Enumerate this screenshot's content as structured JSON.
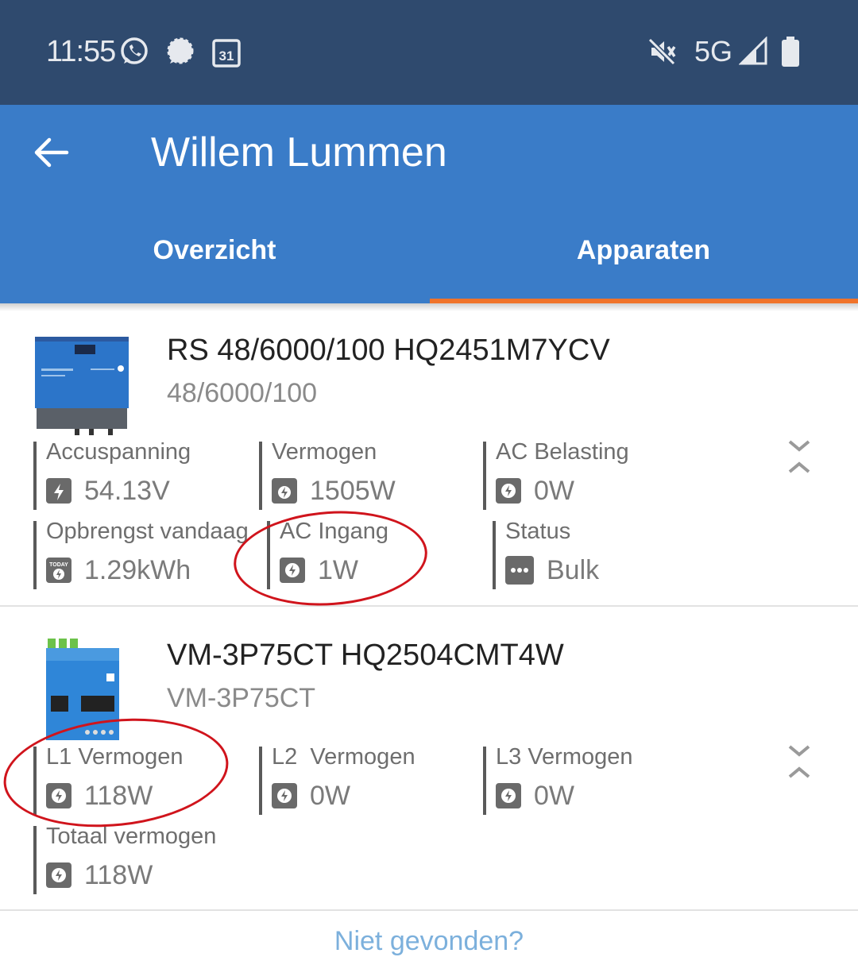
{
  "status_bar": {
    "time": "11:55",
    "network": "5G",
    "icons": [
      "whatsapp-icon",
      "signal-chat-icon",
      "calendar-icon",
      "mute-icon",
      "signal-strength-icon",
      "battery-icon"
    ],
    "calendar_day": "31"
  },
  "app_bar": {
    "title": "Willem Lummen",
    "back_icon": "arrow-left-icon"
  },
  "tabs": [
    {
      "label": "Overzicht",
      "selected": false
    },
    {
      "label": "Apparaten",
      "selected": true
    }
  ],
  "colors": {
    "accent": "#f0732a",
    "appbar": "#3a7cc8",
    "statusbar": "#2f4a6e",
    "annotation": "#d0141c",
    "link": "#7cb0dc"
  },
  "devices": [
    {
      "title": "RS 48/6000/100 HQ2451M7YCV",
      "subtitle": "48/6000/100",
      "items": [
        {
          "label": "Accuspanning",
          "value": "54.13V",
          "icon": "battery-bolt-icon"
        },
        {
          "label": "Vermogen",
          "value": "1505W",
          "icon": "solar-bolt-icon"
        },
        {
          "label": "AC Belasting",
          "value": "0W",
          "icon": "ac-bolt-icon"
        },
        {
          "label": "Opbrengst vandaag",
          "value": "1.29kWh",
          "icon": "today-solar-icon",
          "icon_text": "TODAY"
        },
        {
          "label": "AC Ingang",
          "value": "1W",
          "icon": "ac-bolt-icon"
        },
        {
          "label": "Status",
          "value": "Bulk",
          "icon": "more-dots-icon"
        }
      ]
    },
    {
      "title": "VM-3P75CT HQ2504CMT4W",
      "subtitle": "VM-3P75CT",
      "items": [
        {
          "label": "L1 Vermogen",
          "value": "118W",
          "icon": "ac-bolt-icon"
        },
        {
          "label": "L2  Vermogen",
          "value": "0W",
          "icon": "ac-bolt-icon"
        },
        {
          "label": "L3 Vermogen",
          "value": "0W",
          "icon": "ac-bolt-icon"
        },
        {
          "label": "Totaal vermogen",
          "value": "118W",
          "icon": "ac-bolt-icon"
        }
      ]
    }
  ],
  "footer_link": "Niet gevonden?"
}
